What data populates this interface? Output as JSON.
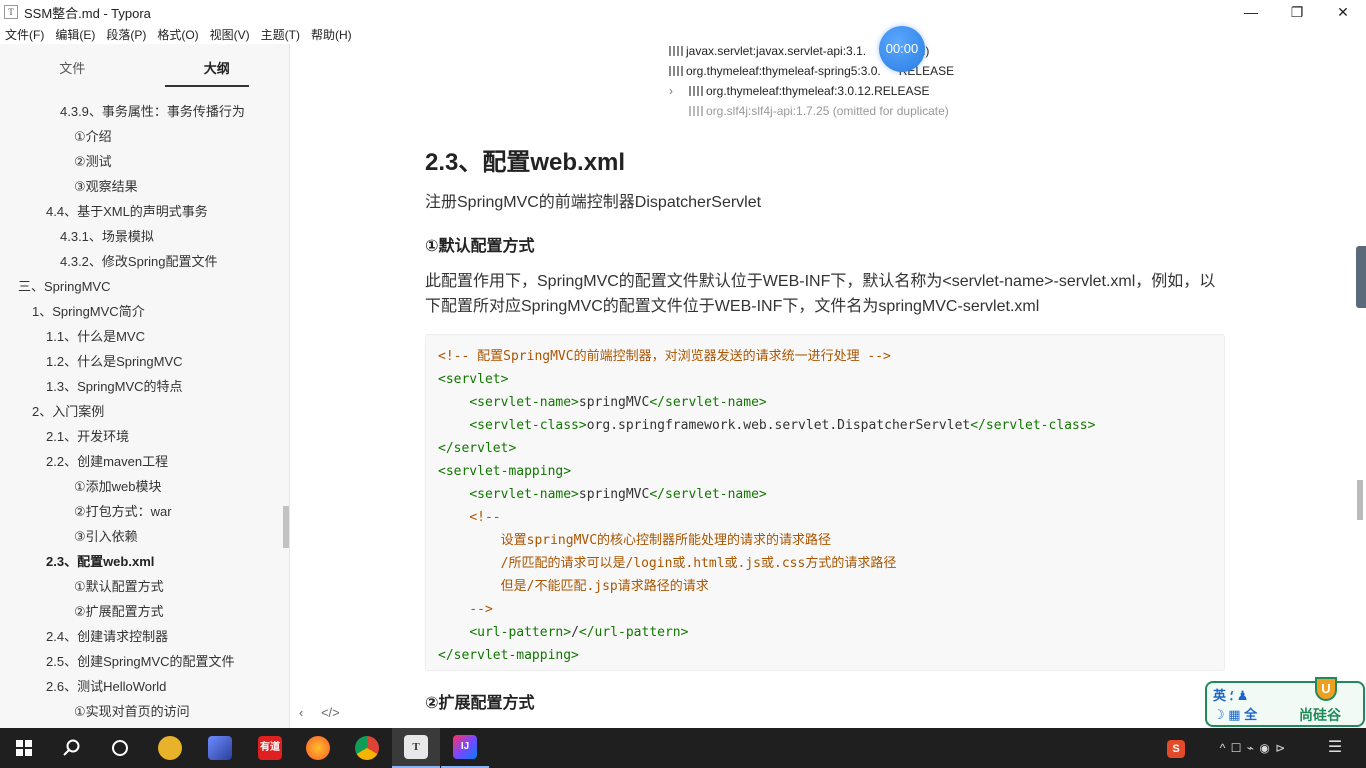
{
  "window": {
    "title": "SSM整合.md - Typora",
    "app_icon": "T",
    "minimize": "—",
    "restore": "❐",
    "close": "✕"
  },
  "menu": [
    "文件(F)",
    "编辑(E)",
    "段落(P)",
    "格式(O)",
    "视图(V)",
    "主题(T)",
    "帮助(H)"
  ],
  "sidebar": {
    "tabs": [
      "文件",
      "大纲"
    ],
    "outline": [
      {
        "label": "4.3.9、事务属性：事务传播行为",
        "level": 4
      },
      {
        "label": "①介绍",
        "level": 5
      },
      {
        "label": "②测试",
        "level": 5
      },
      {
        "label": "③观察结果",
        "level": 5
      },
      {
        "label": "4.4、基于XML的声明式事务",
        "level": 3
      },
      {
        "label": "4.3.1、场景模拟",
        "level": 4
      },
      {
        "label": "4.3.2、修改Spring配置文件",
        "level": 4
      },
      {
        "label": "三、SpringMVC",
        "level": 1
      },
      {
        "label": "1、SpringMVC简介",
        "level": 2
      },
      {
        "label": "1.1、什么是MVC",
        "level": 3
      },
      {
        "label": "1.2、什么是SpringMVC",
        "level": 3
      },
      {
        "label": "1.3、SpringMVC的特点",
        "level": 3
      },
      {
        "label": "2、入门案例",
        "level": 2
      },
      {
        "label": "2.1、开发环境",
        "level": 3
      },
      {
        "label": "2.2、创建maven工程",
        "level": 3
      },
      {
        "label": "①添加web模块",
        "level": 5
      },
      {
        "label": "②打包方式：war",
        "level": 5
      },
      {
        "label": "③引入依赖",
        "level": 5
      },
      {
        "label": "2.3、配置web.xml",
        "level": 3,
        "active": true
      },
      {
        "label": "①默认配置方式",
        "level": 5
      },
      {
        "label": "②扩展配置方式",
        "level": 5
      },
      {
        "label": "2.4、创建请求控制器",
        "level": 3
      },
      {
        "label": "2.5、创建SpringMVC的配置文件",
        "level": 3
      },
      {
        "label": "2.6、测试HelloWorld",
        "level": 3
      },
      {
        "label": "①实现对首页的访问",
        "level": 5
      }
    ]
  },
  "editor": {
    "deps": [
      "javax.servlet:javax.servlet-api:3.1.0 (omitted for duplicate)",
      "org.thymeleaf:thymeleaf-spring5:3.0.12.RELEASE",
      "org.thymeleaf:thymeleaf:3.0.12.RELEASE",
      "org.slf4j:slf4j-api:1.7.25 (omitted for duplicate)"
    ],
    "dep_visible": [
      "javax.servlet:javax.servlet-api:3.1.",
      "ed)",
      "org.thymeleaf:thymeleaf-spring5:3.0.",
      "RELEASE"
    ],
    "timer": "00:00",
    "heading": "2.3、配置web.xml",
    "intro": "注册SpringMVC的前端控制器DispatcherServlet",
    "sub1": "①默认配置方式",
    "para1_line1": "此配置作用下，SpringMVC的配置文件默认位于WEB-INF下，默认名称为<servlet-name>-servlet.xml，例如，以",
    "para1_line2": "下配置所对应SpringMVC的配置文件位于WEB-INF下，文件名为springMVC-servlet.xml",
    "code": [
      [
        {
          "t": "c",
          "v": "<!-- 配置SpringMVC的前端控制器，对浏览器发送的请求统一进行处理 -->"
        }
      ],
      [
        {
          "t": "g",
          "v": "<servlet>"
        }
      ],
      [
        {
          "t": "x",
          "v": "    "
        },
        {
          "t": "g",
          "v": "<servlet-name>"
        },
        {
          "t": "x",
          "v": "springMVC"
        },
        {
          "t": "g",
          "v": "</servlet-name>"
        }
      ],
      [
        {
          "t": "x",
          "v": "    "
        },
        {
          "t": "g",
          "v": "<servlet-class>"
        },
        {
          "t": "x",
          "v": "org.springframework.web.servlet.DispatcherServlet"
        },
        {
          "t": "g",
          "v": "</servlet-class>"
        }
      ],
      [
        {
          "t": "g",
          "v": "</servlet>"
        }
      ],
      [
        {
          "t": "g",
          "v": "<servlet-mapping>"
        }
      ],
      [
        {
          "t": "x",
          "v": "    "
        },
        {
          "t": "g",
          "v": "<servlet-name>"
        },
        {
          "t": "x",
          "v": "springMVC"
        },
        {
          "t": "g",
          "v": "</servlet-name>"
        }
      ],
      [
        {
          "t": "x",
          "v": "    "
        },
        {
          "t": "c",
          "v": "<!--"
        }
      ],
      [
        {
          "t": "c",
          "v": "        设置springMVC的核心控制器所能处理的请求的请求路径"
        }
      ],
      [
        {
          "t": "c",
          "v": "        /所匹配的请求可以是/login或.html或.js或.css方式的请求路径"
        }
      ],
      [
        {
          "t": "c",
          "v": "        但是/不能匹配.jsp请求路径的请求"
        }
      ],
      [
        {
          "t": "c",
          "v": "    -->"
        }
      ],
      [
        {
          "t": "x",
          "v": "    "
        },
        {
          "t": "g",
          "v": "<url-pattern>"
        },
        {
          "t": "x",
          "v": "/"
        },
        {
          "t": "g",
          "v": "</url-pattern>"
        }
      ],
      [
        {
          "t": "g",
          "v": "</servlet-mapping>"
        }
      ]
    ],
    "sub2": "②扩展配置方式",
    "footer_left": "‹",
    "footer_source": "</>"
  },
  "logo": {
    "left_line1": "英 ⸵ ♟",
    "left_line2": "☽ ▦ 全",
    "right": "尚硅谷",
    "badge": "U"
  },
  "taskbar": {
    "items": [
      "start",
      "search",
      "task-view",
      "app-1",
      "app-2",
      "youdao",
      "firefox",
      "chrome",
      "typora",
      "intellij"
    ],
    "youdao_label": "有道",
    "typora_label": "T",
    "intellij_label": "IJ",
    "tray_ime": "S",
    "tray_icons": "^  ☐  ⌁  ◉  ⊳",
    "notify": "☰"
  },
  "colors": {
    "comment": "#aa5500",
    "tag": "#117700",
    "accent": "#2a7de1",
    "logo_green": "#1f8a5a"
  }
}
